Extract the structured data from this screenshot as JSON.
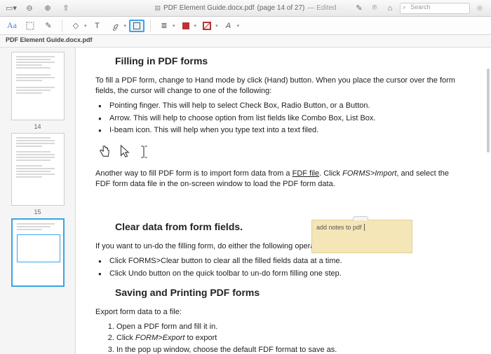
{
  "titlebar": {
    "filename": "PDF Element Guide.docx.pdf",
    "pageinfo": "(page 14 of 27)",
    "status": "— Edited",
    "search_placeholder": "Search"
  },
  "tab": {
    "label": "PDF Element Guide.docx.pdf"
  },
  "sidebar": {
    "page14": "14",
    "page15": "15"
  },
  "doc": {
    "h1": "Filling in PDF forms",
    "p1": "To fill a PDF form, change to Hand mode by click (Hand) button. When you place the cursor over the form fields, the cursor will change to one of the following:",
    "b1": "Pointing finger. This will help to select Check Box, Radio Button, or a Button.",
    "b2": "Arrow. This will help to choose option from list fields like Combo Box, List Box.",
    "b3": "I-beam icon. This will help when you type text into a text filed.",
    "p2a": "Another way to fill PDF form is to import form data from a ",
    "p2b": "FDF file",
    "p2c": ". Click ",
    "p2d": "FORMS>Import",
    "p2e": ", and select the FDF form data file in the on-screen window to load the PDF form data.",
    "note": "add notes to pdf",
    "h2": "Clear data from form fields.",
    "p3": "If you want to un-do the filling form, do either the following operation:",
    "c1": "Click FORMS>Clear button to clear all the filled fields data at a time.",
    "c2": "Click Undo button on the quick toolbar to un-do form filling one step.",
    "h3": "Saving and Printing PDF forms",
    "p4": "Export form data to a file:",
    "n1": "Open a PDF form and fill it in.",
    "n2a": "Click ",
    "n2b": "FORM>Export",
    "n2c": " to export",
    "n3": "In the pop up window, choose the default FDF format to save as."
  }
}
